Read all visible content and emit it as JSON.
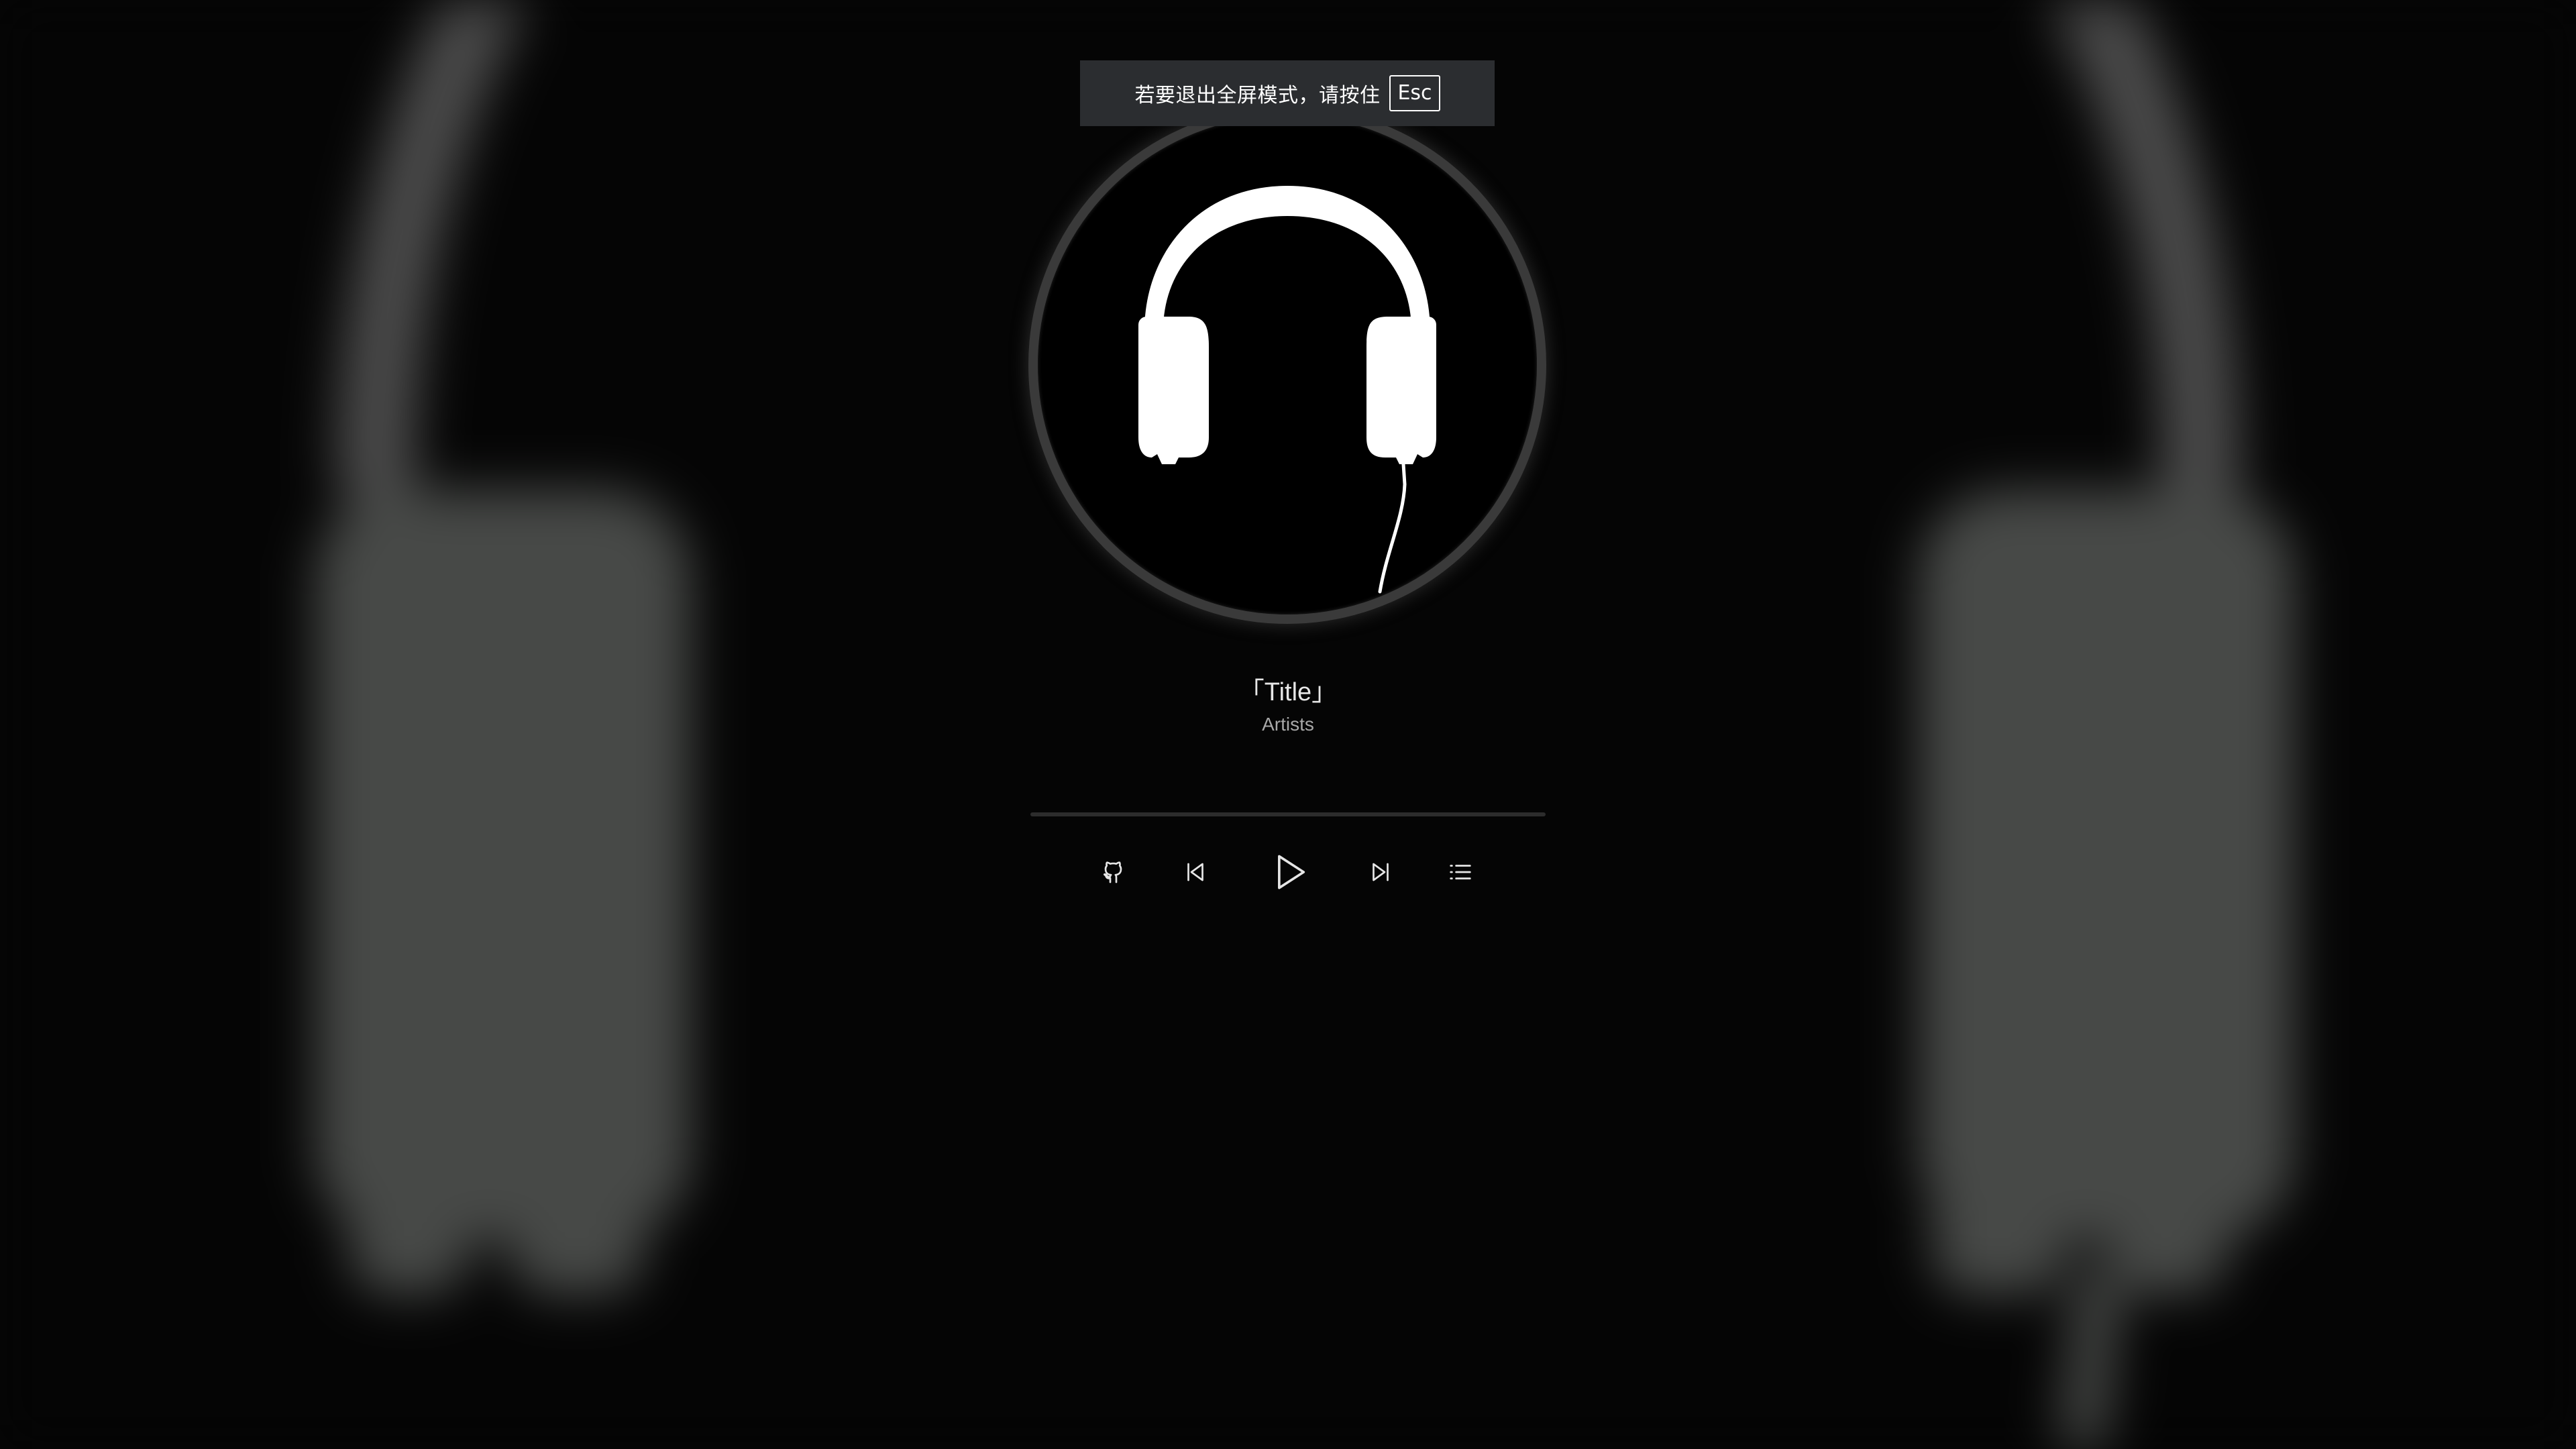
{
  "fullscreen_notice": {
    "message": "若要退出全屏模式，请按住",
    "key": "Esc"
  },
  "track": {
    "title": "「Title」",
    "artist": "Artists"
  },
  "playback": {
    "progress_percent": 0
  },
  "controls": {
    "left_icon": "github-icon",
    "previous_icon": "skip-previous-icon",
    "play_icon": "play-icon",
    "next_icon": "skip-next-icon",
    "playlist_icon": "playlist-icon"
  },
  "colors": {
    "background": "#050505",
    "toast_background": "#2b2d30",
    "cover_ring": "#3a3a3a",
    "text_primary": "#e6e6e6",
    "text_secondary": "#a8a8a8"
  }
}
